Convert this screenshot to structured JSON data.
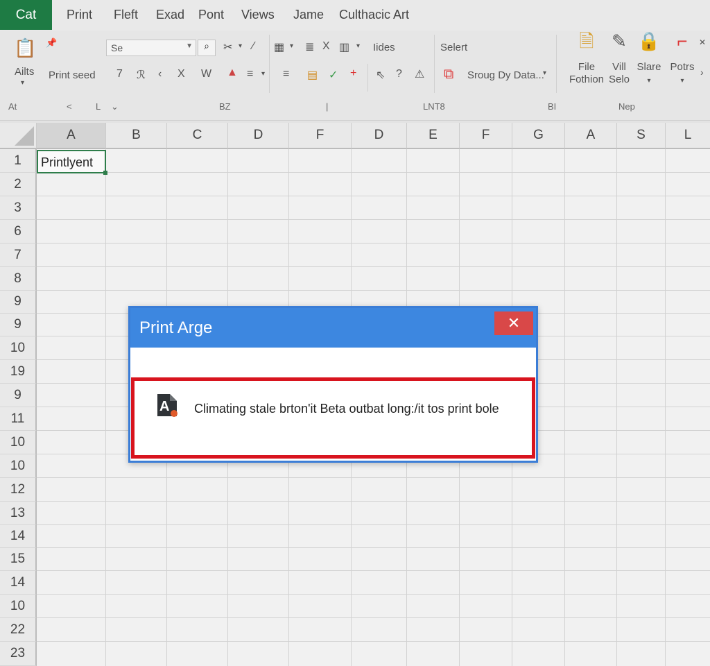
{
  "menubar": {
    "app_tab": "Cat",
    "items": [
      "Print",
      "Fleft",
      "Exad",
      "Pont",
      "Views",
      "Jame",
      "Culthacic Art"
    ]
  },
  "ribbon": {
    "font_box": "Se",
    "paste_label": "Ailts",
    "print_label": "Print ѕeed",
    "hides_label": "Iides",
    "select_label": "Selert",
    "group_by_label": "Sroug Dy Data...",
    "big_buttons": {
      "file": [
        "File",
        "Fothion"
      ],
      "will": [
        "Vill",
        "Selo"
      ],
      "slare": [
        "Slare"
      ],
      "potrs": [
        "Potrs"
      ]
    },
    "group_labels": {
      "at": "At",
      "bz": "BZ",
      "lnt8": "LNT8",
      "bi": "BI",
      "nep": "Nep"
    },
    "group_arrows": {
      "left": "<",
      "l_mark": "L",
      "down": "⌄",
      "pipe": "|"
    }
  },
  "grid": {
    "columns": [
      "A",
      "B",
      "C",
      "D",
      "F",
      "D",
      "E",
      "F",
      "G",
      "A",
      "S",
      "L"
    ],
    "rows": [
      "1",
      "2",
      "3",
      "6",
      "7",
      "8",
      "9",
      "9",
      "10",
      "19",
      "9",
      "11",
      "10",
      "10",
      "12",
      "13",
      "14",
      "15",
      "14",
      "10",
      "22",
      "23"
    ],
    "cell_a1": "Printlyent"
  },
  "dialog": {
    "title": "Print Arge",
    "close_glyph": "✕",
    "message": "Climating stale brton'it Beta outbat long:/it tos print bole",
    "app_icon_letter": "A"
  },
  "colors": {
    "app_tab": "#1e7b44",
    "dialog_title": "#3d87e0",
    "close_button": "#d94848",
    "highlight_border": "#d8141e",
    "active_cell_border": "#2e7d4a"
  }
}
